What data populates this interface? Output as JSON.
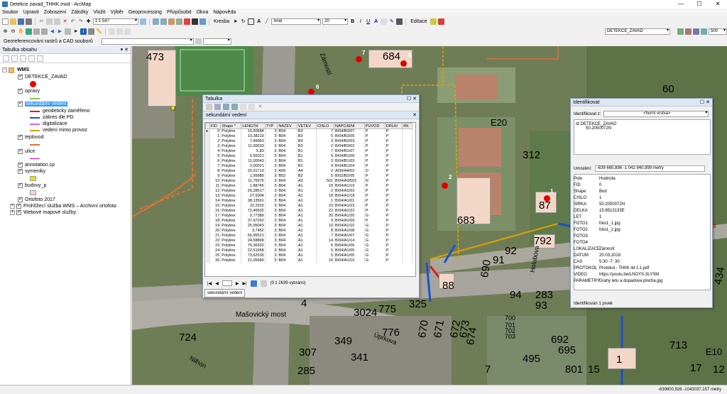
{
  "window": {
    "title": "Detekce zavad_THHK.mxd - ArcMap"
  },
  "menu": [
    "Soubor",
    "Upravit",
    "Zobrazení",
    "Záložky",
    "Vložit",
    "Výběr",
    "Geoprocessing",
    "Přizpůsobit",
    "Okna",
    "Nápověda"
  ],
  "toolbar": {
    "scale": "1:1 547",
    "kresba": "Kresba",
    "font": "Arial",
    "font_size": "20",
    "editace": "Editace",
    "layer": "DETEKCE_ZAVAD",
    "zoom_value": "500",
    "georef": "Georeferencování rastrů a CAD souborů"
  },
  "toc": {
    "title": "Tabulka obsahu",
    "items": {
      "wms": "WMS",
      "detekce": "DETEKCE_ZAVAD",
      "opravy": "opravy",
      "sekundarni": "sekundární vedení",
      "leg1": "geodeticky zaměřeno",
      "leg2": "zákres dle PD",
      "leg3": "digitalizace",
      "leg4": "vedení mimo provoz",
      "teplovod": "teplovod",
      "ulice": "ulice",
      "annotation": "annotation.cp",
      "vymeniky": "vymeniky",
      "budovy": "budovy_p",
      "ortofoto": "Ortofoto 2017",
      "prohlizeci": "Prohlížecí služba WMS – Archivní ortofota",
      "webove": "Webové mapové služby"
    },
    "colors": {
      "red": "#e00000",
      "sek1": "#d42020",
      "sek2": "#1f4fd0",
      "sek3": "#e060e0",
      "sek4": "#e0a000",
      "teplovod": "#e07030",
      "ulice": "#e000e0",
      "vymeniky": "#f0e000",
      "budovy": "#f2d7c7"
    }
  },
  "table_window": {
    "title": "Tabulka",
    "tab": "sekundární vedení",
    "columns": [
      "FID",
      "Shape *",
      "LENGTH",
      "TYP",
      "NAZEV",
      "VETEV",
      "CISLO",
      "NAPOJENI",
      "PUVOD",
      "DRUH",
      "RK"
    ],
    "rows": [
      [
        "0",
        "Polyline",
        "15,50684",
        "3",
        "B04",
        "B3",
        "7",
        "B/04/B3/07",
        "P",
        "P"
      ],
      [
        "1",
        "Polyline",
        "10,38219",
        "3",
        "B04",
        "B3",
        "5",
        "B/04/B3/05",
        "P",
        "P"
      ],
      [
        "2",
        "Polyline",
        "7,99953",
        "3",
        "B04",
        "B3",
        "3",
        "B/04/B3/03",
        "P",
        "P"
      ],
      [
        "3",
        "Polyline",
        "11,00033",
        "3",
        "B04",
        "B3",
        "2",
        "B/04/B3/02",
        "P",
        "P"
      ],
      [
        "4",
        "Polyline",
        "5,83",
        "3",
        "B04",
        "B1",
        "7",
        "B/04/B1/07",
        "P",
        "P"
      ],
      [
        "5",
        "Polyline",
        "5,55021",
        "3",
        "B04",
        "B1",
        "5",
        "B/04/B1/05",
        "P",
        "P"
      ],
      [
        "6",
        "Polyline",
        "11,00043",
        "3",
        "B04",
        "B1",
        "3",
        "B/04/B1/03",
        "P",
        "P"
      ],
      [
        "7",
        "Polyline",
        "2,00021",
        "3",
        "B04",
        "B1",
        "4",
        "B/04/B1/04",
        "P",
        "P"
      ],
      [
        "8",
        "Polyline",
        "20,01713",
        "3",
        "A09",
        "A4",
        "2",
        "A/09/A4/02",
        "D",
        "P"
      ],
      [
        "9",
        "Polyline",
        "1,99985",
        "3",
        "B02",
        "B2",
        "5",
        "B/02/B2/05",
        "P",
        "P"
      ],
      [
        "10",
        "Polyline",
        "11,75976",
        "3",
        "B04",
        "A3",
        "501",
        "B/04/A3/501",
        "N",
        "P"
      ],
      [
        "11",
        "Polyline",
        "1,88745",
        "3",
        "B04",
        "A1",
        "19",
        "B/04/A1/19",
        "P",
        "P"
      ],
      [
        "12",
        "Polyline",
        "26,28517",
        "3",
        "B04",
        "A1",
        "2",
        "B/04/A1/02",
        "P",
        "P"
      ],
      [
        "13",
        "Polyline",
        "27,5004",
        "3",
        "B04",
        "A1",
        "18",
        "B/04/A1/18",
        "P",
        "P"
      ],
      [
        "14",
        "Polyline",
        "38,13561",
        "3",
        "B04",
        "A1",
        "1",
        "B/04/A1/01",
        "P",
        "P"
      ],
      [
        "15",
        "Polyline",
        "22,2915",
        "3",
        "B04",
        "A1",
        "23",
        "B/04/A1/23",
        "P",
        "P"
      ],
      [
        "16",
        "Polyline",
        "72,46502",
        "3",
        "B04",
        "A1",
        "22",
        "B/04/A1/22",
        "P",
        "P"
      ],
      [
        "17",
        "Polyline",
        "0,77389",
        "3",
        "B04",
        "A1",
        "20",
        "B/04/A1/20",
        "G",
        "P"
      ],
      [
        "18",
        "Polyline",
        "37,97262",
        "3",
        "B04",
        "A1",
        "9",
        "B/04/A1/09",
        "P",
        "P"
      ],
      [
        "19",
        "Polyline",
        "25,95043",
        "3",
        "B04",
        "A1",
        "10",
        "B/04/A1/10",
        "G",
        "P"
      ],
      [
        "20",
        "Polyline",
        "3,7452",
        "3",
        "B04",
        "A1",
        "8",
        "B/04/A1/08",
        "G",
        "P"
      ],
      [
        "21",
        "Polyline",
        "56,95521",
        "3",
        "B04",
        "A1",
        "7",
        "B/04/A1/07",
        "G",
        "P"
      ],
      [
        "22",
        "Polyline",
        "24,58868",
        "3",
        "B04",
        "A1",
        "14",
        "B/04/A1/14",
        "G",
        "P"
      ],
      [
        "23",
        "Polyline",
        "75,36302",
        "3",
        "B04",
        "A1",
        "6",
        "B/04/A1/06",
        "G",
        "P"
      ],
      [
        "24",
        "Polyline",
        "22,51958",
        "3",
        "B04",
        "A1",
        "5",
        "B/04/A1/05",
        "G",
        "P"
      ],
      [
        "25",
        "Polyline",
        "73,62535",
        "3",
        "B04",
        "A1",
        "5",
        "B/04/A1/05",
        "G",
        "P"
      ],
      [
        "26",
        "Polyline",
        "21,05689",
        "3",
        "B04",
        "A1",
        "16",
        "B/04/A1/16",
        "G",
        "P"
      ]
    ],
    "record_nav": "(0 z 2639 vybráno)",
    "bottom_tab": "sekundární vedení"
  },
  "identify": {
    "title": "Identifikovat",
    "from_label": "Identifikovat z:",
    "from_value": "<horní vrstva>",
    "tree_layer": "DETEKCE_ZAVAD",
    "tree_feature": "50.2050072N",
    "location_label": "Umístění:",
    "location_value": "-639 665,896  -1 042 940,999 metry",
    "headers": {
      "field": "Pole",
      "value": "Hodnota"
    },
    "fields": [
      [
        "FID",
        "0"
      ],
      [
        "Shape",
        "Bod"
      ],
      [
        "CISLO",
        "1"
      ],
      [
        "SIRKA",
        "50.2050072N"
      ],
      [
        "DELKA",
        "15.8513133E"
      ],
      [
        "LET",
        "1"
      ],
      [
        "FOTO1",
        "foto1_1.jpg"
      ],
      [
        "FOTO2",
        "foto1_2.jpg"
      ],
      [
        "FOTO3",
        ""
      ],
      [
        "FOTO4",
        ""
      ],
      [
        "LOKALIZACE",
        "Zámostí"
      ],
      [
        "DATUM",
        "20.03.2018"
      ],
      [
        "CAS",
        "5:30 -7: 30"
      ],
      [
        "PROTOKOL",
        "Protokol - THhK let č.1.pdf"
      ],
      [
        "VIDEO",
        "https://youtu.be/LNOYS-3LYSM"
      ],
      [
        "PARAMETRY",
        "Drahy letu a dopadova plocha.jpg"
      ]
    ],
    "footer": "Identifikován 1 prvek"
  },
  "map": {
    "labels": {
      "n473": "473",
      "n684": "684",
      "n60": "60",
      "zamosti": "Zámostí",
      "e20": "E20",
      "n312": "312",
      "n87": "87",
      "n683": "683",
      "n792": "792",
      "n92": "92",
      "n91": "91",
      "n690": "690",
      "hol": "Holubova",
      "n88": "88",
      "n434": "434",
      "n94": "94",
      "n283": "283",
      "n93": "93",
      "n4": "4",
      "n325": "325",
      "most": "Mašovický most",
      "n3024": "3024",
      "n775": "775",
      "n670": "670",
      "n671": "671",
      "n672": "672",
      "n673": "673",
      "n674": "674",
      "n7007": "700",
      "n701": "701",
      "n702": "702",
      "n703": "703",
      "n724": "724",
      "n349": "349",
      "n776": "776",
      "uprkova": "Úprkova",
      "n692": "692",
      "n695": "695",
      "n713": "713",
      "n307": "307",
      "n341": "341",
      "n495": "495",
      "n285": "285",
      "n7": "7",
      "n801": "801",
      "n15": "15",
      "n1": "1",
      "n17": "17",
      "e10": "E10",
      "n12": "12",
      "nilhon": "Nilhon",
      "n5": "5",
      "n6": "6",
      "n2": "2",
      "n1b": "1",
      "n3": "3",
      "n7b": "7"
    }
  },
  "status": {
    "coords": "-639800,926  -1043037,157 metry"
  }
}
